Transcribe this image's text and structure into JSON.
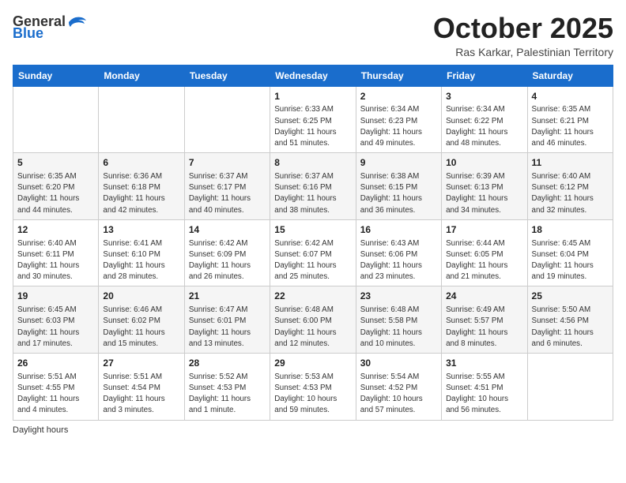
{
  "header": {
    "logo_general": "General",
    "logo_blue": "Blue",
    "month": "October 2025",
    "location": "Ras Karkar, Palestinian Territory"
  },
  "days_of_week": [
    "Sunday",
    "Monday",
    "Tuesday",
    "Wednesday",
    "Thursday",
    "Friday",
    "Saturday"
  ],
  "weeks": [
    [
      {
        "day": "",
        "info": ""
      },
      {
        "day": "",
        "info": ""
      },
      {
        "day": "",
        "info": ""
      },
      {
        "day": "1",
        "info": "Sunrise: 6:33 AM\nSunset: 6:25 PM\nDaylight: 11 hours\nand 51 minutes."
      },
      {
        "day": "2",
        "info": "Sunrise: 6:34 AM\nSunset: 6:23 PM\nDaylight: 11 hours\nand 49 minutes."
      },
      {
        "day": "3",
        "info": "Sunrise: 6:34 AM\nSunset: 6:22 PM\nDaylight: 11 hours\nand 48 minutes."
      },
      {
        "day": "4",
        "info": "Sunrise: 6:35 AM\nSunset: 6:21 PM\nDaylight: 11 hours\nand 46 minutes."
      }
    ],
    [
      {
        "day": "5",
        "info": "Sunrise: 6:35 AM\nSunset: 6:20 PM\nDaylight: 11 hours\nand 44 minutes."
      },
      {
        "day": "6",
        "info": "Sunrise: 6:36 AM\nSunset: 6:18 PM\nDaylight: 11 hours\nand 42 minutes."
      },
      {
        "day": "7",
        "info": "Sunrise: 6:37 AM\nSunset: 6:17 PM\nDaylight: 11 hours\nand 40 minutes."
      },
      {
        "day": "8",
        "info": "Sunrise: 6:37 AM\nSunset: 6:16 PM\nDaylight: 11 hours\nand 38 minutes."
      },
      {
        "day": "9",
        "info": "Sunrise: 6:38 AM\nSunset: 6:15 PM\nDaylight: 11 hours\nand 36 minutes."
      },
      {
        "day": "10",
        "info": "Sunrise: 6:39 AM\nSunset: 6:13 PM\nDaylight: 11 hours\nand 34 minutes."
      },
      {
        "day": "11",
        "info": "Sunrise: 6:40 AM\nSunset: 6:12 PM\nDaylight: 11 hours\nand 32 minutes."
      }
    ],
    [
      {
        "day": "12",
        "info": "Sunrise: 6:40 AM\nSunset: 6:11 PM\nDaylight: 11 hours\nand 30 minutes."
      },
      {
        "day": "13",
        "info": "Sunrise: 6:41 AM\nSunset: 6:10 PM\nDaylight: 11 hours\nand 28 minutes."
      },
      {
        "day": "14",
        "info": "Sunrise: 6:42 AM\nSunset: 6:09 PM\nDaylight: 11 hours\nand 26 minutes."
      },
      {
        "day": "15",
        "info": "Sunrise: 6:42 AM\nSunset: 6:07 PM\nDaylight: 11 hours\nand 25 minutes."
      },
      {
        "day": "16",
        "info": "Sunrise: 6:43 AM\nSunset: 6:06 PM\nDaylight: 11 hours\nand 23 minutes."
      },
      {
        "day": "17",
        "info": "Sunrise: 6:44 AM\nSunset: 6:05 PM\nDaylight: 11 hours\nand 21 minutes."
      },
      {
        "day": "18",
        "info": "Sunrise: 6:45 AM\nSunset: 6:04 PM\nDaylight: 11 hours\nand 19 minutes."
      }
    ],
    [
      {
        "day": "19",
        "info": "Sunrise: 6:45 AM\nSunset: 6:03 PM\nDaylight: 11 hours\nand 17 minutes."
      },
      {
        "day": "20",
        "info": "Sunrise: 6:46 AM\nSunset: 6:02 PM\nDaylight: 11 hours\nand 15 minutes."
      },
      {
        "day": "21",
        "info": "Sunrise: 6:47 AM\nSunset: 6:01 PM\nDaylight: 11 hours\nand 13 minutes."
      },
      {
        "day": "22",
        "info": "Sunrise: 6:48 AM\nSunset: 6:00 PM\nDaylight: 11 hours\nand 12 minutes."
      },
      {
        "day": "23",
        "info": "Sunrise: 6:48 AM\nSunset: 5:58 PM\nDaylight: 11 hours\nand 10 minutes."
      },
      {
        "day": "24",
        "info": "Sunrise: 6:49 AM\nSunset: 5:57 PM\nDaylight: 11 hours\nand 8 minutes."
      },
      {
        "day": "25",
        "info": "Sunrise: 5:50 AM\nSunset: 4:56 PM\nDaylight: 11 hours\nand 6 minutes."
      }
    ],
    [
      {
        "day": "26",
        "info": "Sunrise: 5:51 AM\nSunset: 4:55 PM\nDaylight: 11 hours\nand 4 minutes."
      },
      {
        "day": "27",
        "info": "Sunrise: 5:51 AM\nSunset: 4:54 PM\nDaylight: 11 hours\nand 3 minutes."
      },
      {
        "day": "28",
        "info": "Sunrise: 5:52 AM\nSunset: 4:53 PM\nDaylight: 11 hours\nand 1 minute."
      },
      {
        "day": "29",
        "info": "Sunrise: 5:53 AM\nSunset: 4:53 PM\nDaylight: 10 hours\nand 59 minutes."
      },
      {
        "day": "30",
        "info": "Sunrise: 5:54 AM\nSunset: 4:52 PM\nDaylight: 10 hours\nand 57 minutes."
      },
      {
        "day": "31",
        "info": "Sunrise: 5:55 AM\nSunset: 4:51 PM\nDaylight: 10 hours\nand 56 minutes."
      },
      {
        "day": "",
        "info": ""
      }
    ]
  ],
  "footer": {
    "note": "Daylight hours"
  }
}
